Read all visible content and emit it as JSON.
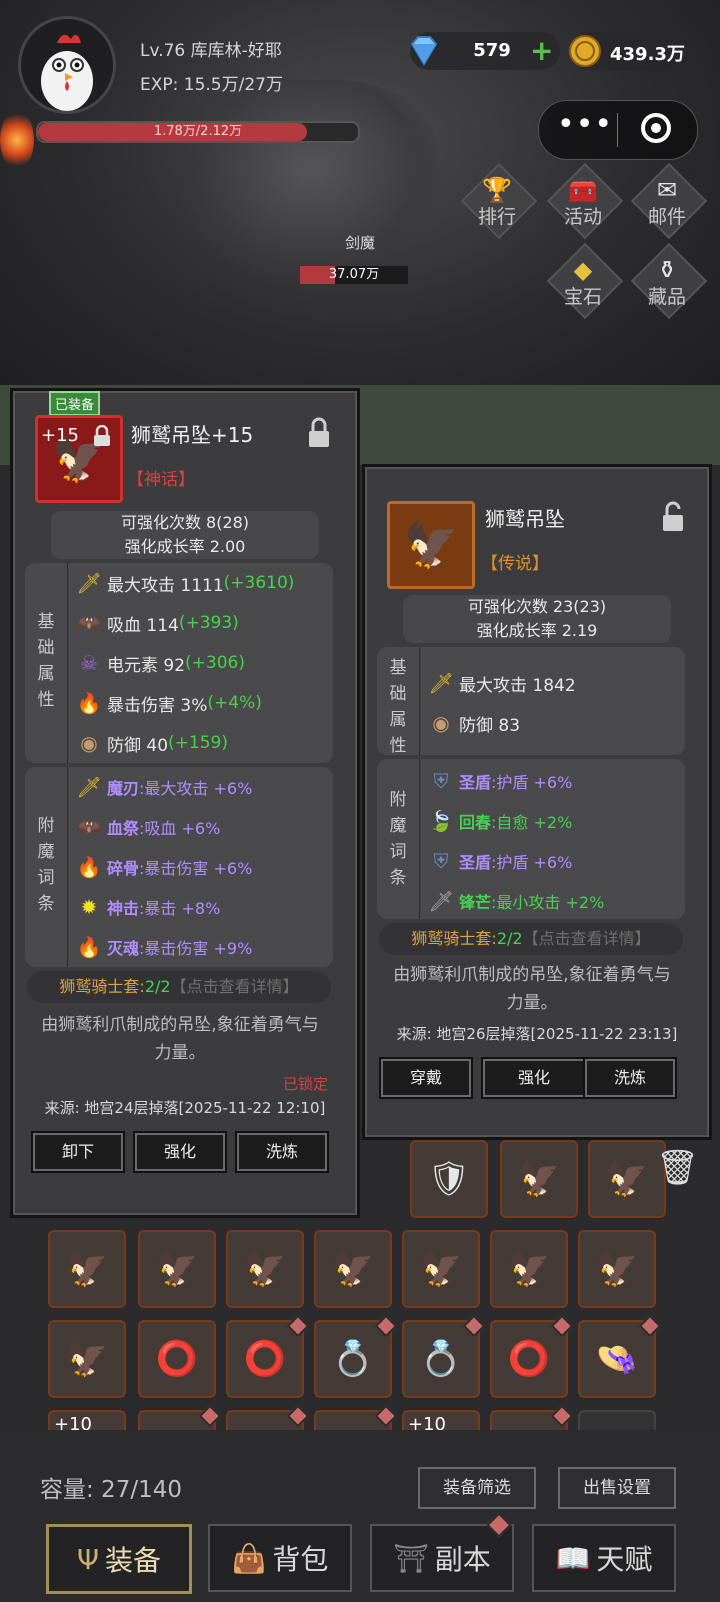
{
  "player": {
    "name_line": "Lv.76 库库林-好耶",
    "exp_line": "EXP: 15.5万/27万",
    "hp_text": "1.78万/2.12万",
    "hp_fraction": 0.84
  },
  "currency": {
    "gems": "579",
    "gem_plus": "+",
    "coins": "439.3万"
  },
  "capsule": {
    "dots": "•••"
  },
  "side_menu": [
    {
      "label": "排行",
      "icon": "trophy-icon"
    },
    {
      "label": "活动",
      "icon": "chest-icon"
    },
    {
      "label": "邮件",
      "icon": "mail-icon"
    },
    {
      "label": "宝石",
      "icon": "gem-icon"
    },
    {
      "label": "藏品",
      "icon": "collection-icon"
    }
  ],
  "boss": {
    "name": "剑魔",
    "hp_text": "37.07万",
    "hp_fraction": 0.32
  },
  "equipped_item": {
    "equipped_badge": "已装备",
    "level_tag": "+15",
    "name": "狮鹫吊坠+15",
    "rarity": "【神话】",
    "upgrade_count": "可强化次数 8(28)",
    "growth_rate": "强化成长率 2.00",
    "base_label": "基础属性",
    "base_stats": [
      {
        "icon": "sword-icon",
        "text": "最大攻击 1111 ",
        "bonus": "(+3610)"
      },
      {
        "icon": "bat-icon",
        "text": "吸血 114 ",
        "bonus": "(+393)"
      },
      {
        "icon": "skull-icon",
        "text": "电元素 92 ",
        "bonus": "(+306)"
      },
      {
        "icon": "crit-icon",
        "text": "暴击伤害 3% ",
        "bonus": "(+4%)"
      },
      {
        "icon": "shield-round-icon",
        "text": "防御 40 ",
        "bonus": "(+159)"
      }
    ],
    "affix_label": "附魔词条",
    "affixes": [
      {
        "icon": "sword-icon",
        "name": "魔刃",
        "text": ":最大攻击 +6%",
        "color": "purple"
      },
      {
        "icon": "bat-icon",
        "name": "血祭",
        "text": ":吸血 +6%",
        "color": "purple"
      },
      {
        "icon": "crit-icon",
        "name": "碎骨",
        "text": ":暴击伤害 +6%",
        "color": "purple"
      },
      {
        "icon": "burst-icon",
        "name": "神击",
        "text": ":暴击 +8%",
        "color": "purple"
      },
      {
        "icon": "crit-icon",
        "name": "灭魂",
        "text": ":暴击伤害 +9%",
        "color": "purple"
      }
    ],
    "set_name": "狮鹫骑士套:",
    "set_count": "2/2",
    "set_link": "【点击查看详情】",
    "description": "由狮鹫利爪制成的吊坠,象征着勇气与力量。",
    "locked_text": "已锁定",
    "source": "来源: 地宫24层掉落[2025-11-22 12:10]",
    "buttons": [
      "卸下",
      "强化",
      "洗炼"
    ]
  },
  "compare_item": {
    "name": "狮鹫吊坠",
    "rarity": "【传说】",
    "upgrade_count": "可强化次数 23(23)",
    "growth_rate": "强化成长率 2.19",
    "base_label": "基础属性",
    "base_stats": [
      {
        "icon": "sword-icon",
        "text": "最大攻击 1842"
      },
      {
        "icon": "shield-round-icon",
        "text": "防御 83"
      }
    ],
    "affix_label": "附魔词条",
    "affixes": [
      {
        "icon": "shield-icon",
        "name": "圣盾",
        "text": ":护盾 +6%",
        "color": "purple"
      },
      {
        "icon": "leaf-icon",
        "name": "回春",
        "text": ":自愈 +2%",
        "color": "green"
      },
      {
        "icon": "shield-icon",
        "name": "圣盾",
        "text": ":护盾 +6%",
        "color": "purple"
      },
      {
        "icon": "dagger-icon",
        "name": "锋芒",
        "text": ":最小攻击 +2%",
        "color": "green"
      }
    ],
    "set_name": "狮鹫骑士套:",
    "set_count": "2/2",
    "set_link": "【点击查看详情】",
    "description": "由狮鹫利爪制成的吊坠,象征着勇气与力量。",
    "source": "来源: 地宫26层掉落[2025-11-22 23:13]",
    "buttons": [
      "穿戴",
      "强化",
      "洗炼"
    ]
  },
  "inventory": {
    "capacity": "容量: 27/140",
    "filter_button": "装备筛选",
    "sell_button": "出售设置",
    "grid_plus_a": "+10",
    "grid_plus_b": "+10"
  },
  "nav": [
    {
      "label": "装备",
      "icon": "trident-icon",
      "active": true
    },
    {
      "label": "背包",
      "icon": "bag-icon",
      "active": false
    },
    {
      "label": "副本",
      "icon": "gate-icon",
      "active": false
    },
    {
      "label": "天赋",
      "icon": "book-icon",
      "active": false
    }
  ],
  "colors": {
    "bonus_green": "#47d24a",
    "rarity_red": "#d94040",
    "rarity_orange": "#e0902a",
    "affix_purple": "#b08cff",
    "affix_green": "#48d050",
    "set_gold": "#e0a040"
  }
}
